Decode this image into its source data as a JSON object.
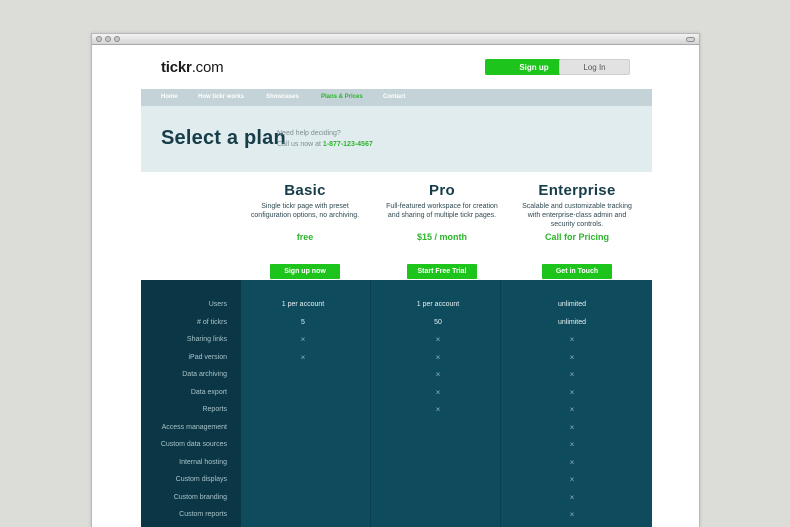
{
  "site": {
    "logo_bold": "tickr",
    "logo_rest": ".com",
    "signup_label": "Sign up",
    "login_label": "Log In"
  },
  "nav": {
    "items": [
      {
        "label": "Home"
      },
      {
        "label": "How tickr works"
      },
      {
        "label": "Showcases"
      },
      {
        "label": "Plans & Prices"
      },
      {
        "label": "Contact"
      }
    ],
    "active": "Plans & Prices"
  },
  "hero": {
    "title": "Select a plan",
    "help_line1": "Need help deciding?",
    "help_line2_prefix": "Call us now at ",
    "phone": "1-877-123-4567"
  },
  "plans": [
    {
      "name": "Basic",
      "desc": "Single tickr page with preset configuration options, no archiving.",
      "price": "free",
      "cta": "Sign up now"
    },
    {
      "name": "Pro",
      "desc": "Full-featured workspace for creation and sharing of multiple tickr pages.",
      "price": "$15 / month",
      "cta": "Start Free Trial"
    },
    {
      "name": "Enterprise",
      "desc": "Scalable and customizable tracking with enterprise-class admin and security controls.",
      "price": "Call for Pricing",
      "cta": "Get in Touch"
    }
  ],
  "features": {
    "rows": [
      {
        "label": "Users",
        "values": [
          "1 per account",
          "1 per account",
          "unlimited"
        ]
      },
      {
        "label": "# of tickrs",
        "values": [
          "5",
          "50",
          "unlimited"
        ]
      },
      {
        "label": "Sharing links",
        "values": [
          "×",
          "×",
          "×"
        ]
      },
      {
        "label": "iPad version",
        "values": [
          "×",
          "×",
          "×"
        ]
      },
      {
        "label": "Data archiving",
        "values": [
          "",
          "×",
          "×"
        ]
      },
      {
        "label": "Data export",
        "values": [
          "",
          "×",
          "×"
        ]
      },
      {
        "label": "Reports",
        "values": [
          "",
          "×",
          "×"
        ]
      },
      {
        "label": "Access management",
        "values": [
          "",
          "",
          "×"
        ]
      },
      {
        "label": "Custom data sources",
        "values": [
          "",
          "",
          "×"
        ]
      },
      {
        "label": "Internal hosting",
        "values": [
          "",
          "",
          "×"
        ]
      },
      {
        "label": "Custom displays",
        "values": [
          "",
          "",
          "×"
        ]
      },
      {
        "label": "Custom branding",
        "values": [
          "",
          "",
          "×"
        ]
      },
      {
        "label": "Custom reports",
        "values": [
          "",
          "",
          "×"
        ]
      }
    ]
  },
  "colors": {
    "accent_green": "#1cc41c",
    "navy_text": "#163d48",
    "table_bg": "#0e4b5d"
  }
}
